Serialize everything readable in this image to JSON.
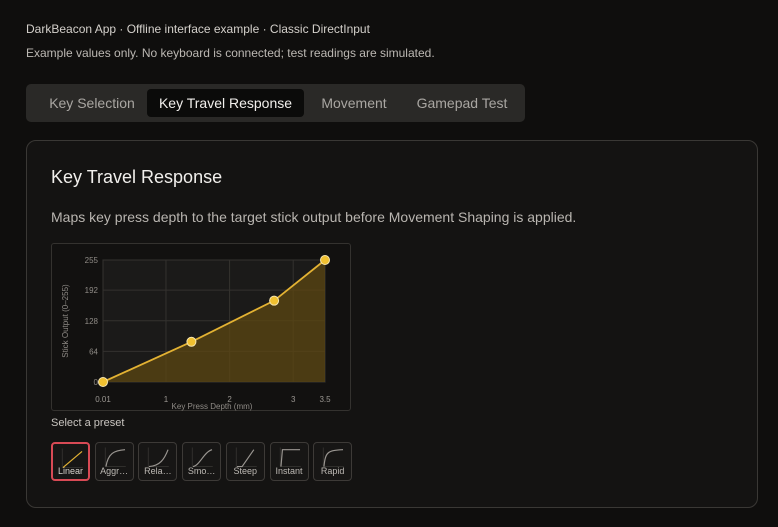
{
  "header": {
    "line1": "DarkBeacon App · Offline interface example · Classic DirectInput",
    "line2": "Example values only. No keyboard is connected; test readings are simulated."
  },
  "tabs": [
    {
      "label": "Key Selection",
      "active": false
    },
    {
      "label": "Key Travel Response",
      "active": true
    },
    {
      "label": "Movement",
      "active": false
    },
    {
      "label": "Gamepad Test",
      "active": false
    }
  ],
  "panel": {
    "title": "Key Travel Response",
    "description": "Maps key press depth to the target stick output before Movement Shaping is applied."
  },
  "chart_data": {
    "type": "line",
    "xlabel": "Key Press Depth (mm)",
    "ylabel": "Stick Output (0–255)",
    "x_ticks": [
      "0.01",
      "1",
      "2",
      "3",
      "3.5"
    ],
    "y_ticks": [
      "0",
      "64",
      "128",
      "192",
      "255"
    ],
    "xlim": [
      0.01,
      3.5
    ],
    "ylim": [
      0,
      255
    ],
    "x": [
      0.01,
      1.4,
      2.7,
      3.5
    ],
    "y": [
      0,
      84,
      170,
      255
    ],
    "grid": true,
    "filled": true,
    "colors": {
      "line": "#e3b233",
      "fill": "#5c4712",
      "point": "#f0c030"
    }
  },
  "presets": {
    "label": "Select a preset",
    "items": [
      {
        "label": "Linear",
        "selected": true
      },
      {
        "label": "Aggr…",
        "selected": false
      },
      {
        "label": "Rela…",
        "selected": false
      },
      {
        "label": "Smo…",
        "selected": false
      },
      {
        "label": "Steep",
        "selected": false
      },
      {
        "label": "Instant",
        "selected": false
      },
      {
        "label": "Rapid",
        "selected": false
      }
    ]
  }
}
